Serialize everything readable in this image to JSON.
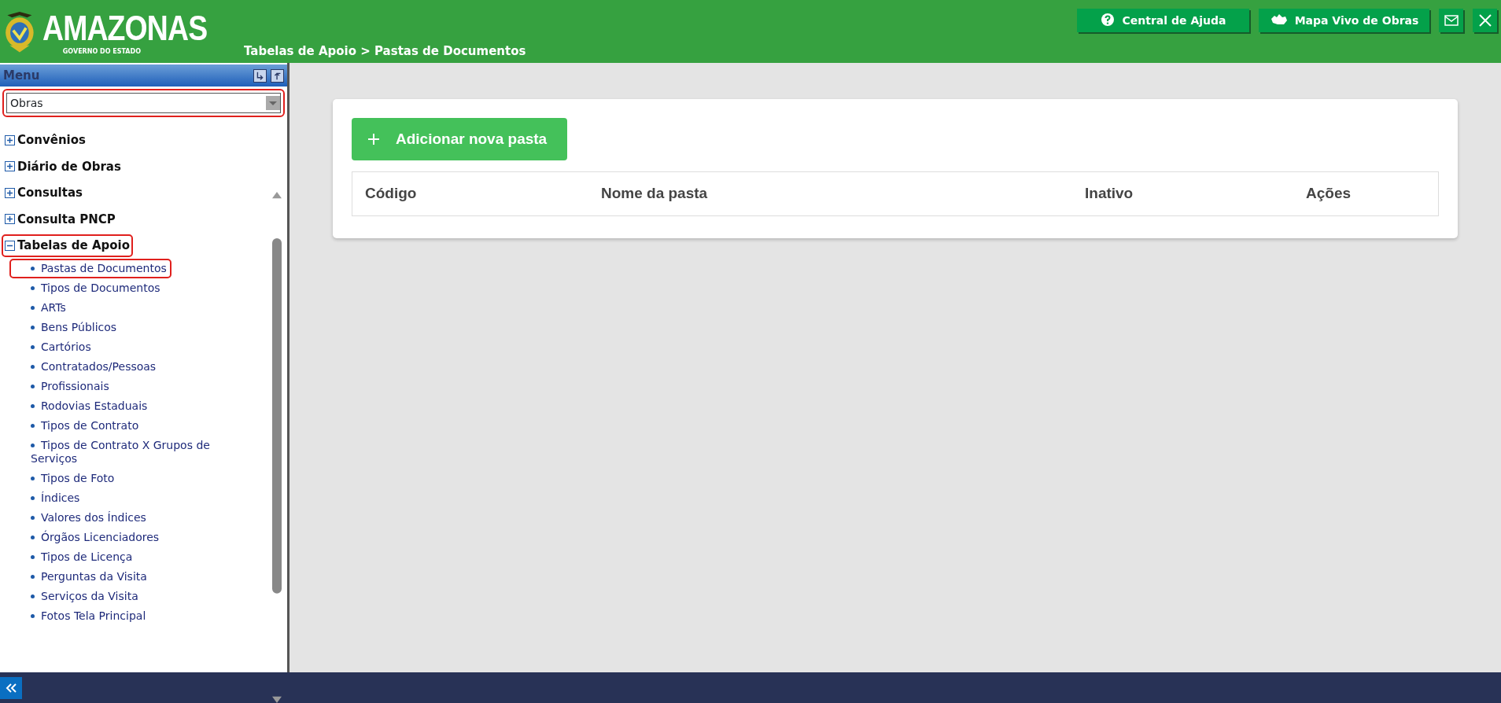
{
  "header": {
    "logo_title": "AMAZONAS",
    "logo_subtitle": "GOVERNO DO ESTADO",
    "breadcrumb": "Tabelas de Apoio > Pastas de Documentos",
    "buttons": [
      {
        "label": "Central de Ajuda",
        "kind": "help"
      },
      {
        "label": "Mapa Vivo de Obras",
        "kind": "map"
      },
      {
        "kind": "mail"
      },
      {
        "kind": "close"
      }
    ]
  },
  "sidebar": {
    "title": "Menu",
    "module_select": {
      "value": "Obras",
      "highlighted": true
    },
    "items": [
      {
        "label": "Convênios",
        "expanded": false,
        "highlighted": false
      },
      {
        "label": "Diário de Obras",
        "expanded": false,
        "highlighted": false
      },
      {
        "label": "Consultas",
        "expanded": false,
        "highlighted": false
      },
      {
        "label": "Consulta PNCP",
        "expanded": false,
        "highlighted": false
      },
      {
        "label": "Tabelas de Apoio",
        "expanded": true,
        "highlighted": true,
        "children": [
          {
            "label": "Pastas de Documentos",
            "highlighted": true
          },
          {
            "label": "Tipos de Documentos",
            "highlighted": false
          },
          {
            "label": "ARTs",
            "highlighted": false
          },
          {
            "label": "Bens Públicos",
            "highlighted": false
          },
          {
            "label": "Cartórios",
            "highlighted": false
          },
          {
            "label": "Contratados/Pessoas",
            "highlighted": false
          },
          {
            "label": "Profissionais",
            "highlighted": false
          },
          {
            "label": "Rodovias Estaduais",
            "highlighted": false
          },
          {
            "label": "Tipos de Contrato",
            "highlighted": false
          },
          {
            "label": "Tipos de Contrato X Grupos de Serviços",
            "highlighted": false
          },
          {
            "label": "Tipos de Foto",
            "highlighted": false
          },
          {
            "label": "Índices",
            "highlighted": false
          },
          {
            "label": "Valores dos Índices",
            "highlighted": false
          },
          {
            "label": "Órgãos Licenciadores",
            "highlighted": false
          },
          {
            "label": "Tipos de Licença",
            "highlighted": false
          },
          {
            "label": "Perguntas da Visita",
            "highlighted": false
          },
          {
            "label": "Serviços da Visita",
            "highlighted": false
          },
          {
            "label": "Fotos Tela Principal",
            "highlighted": false
          }
        ]
      }
    ]
  },
  "main": {
    "add_button": "Adicionar nova pasta",
    "table": {
      "columns": [
        "Código",
        "Nome da pasta",
        "Inativo",
        "Ações"
      ]
    }
  }
}
